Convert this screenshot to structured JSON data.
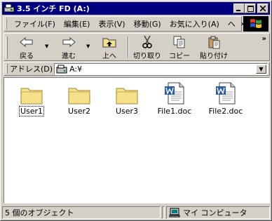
{
  "window": {
    "title": "3.5 インチ FD (A:)",
    "buttons": {
      "minimize": "_",
      "maximize": "□",
      "close": "×"
    }
  },
  "menu": {
    "items": [
      "ファイル(F)",
      "編集(E)",
      "表示(V)",
      "移動(G)",
      "お気に入り(A)",
      "ヘ"
    ],
    "more": "»"
  },
  "toolbar": {
    "back": "戻る",
    "forward": "進む",
    "up": "上へ",
    "cut": "切り取り",
    "copy": "コピー",
    "paste": "貼り付け",
    "more": "»",
    "dropdown_glyph": "▼"
  },
  "address": {
    "label": "アドレス(D)",
    "value": "A:¥",
    "dropdown_glyph": "▼"
  },
  "files": [
    {
      "name": "User1",
      "kind": "folder",
      "icon": "folder-icon"
    },
    {
      "name": "User2",
      "kind": "folder",
      "icon": "folder-icon"
    },
    {
      "name": "User3",
      "kind": "folder",
      "icon": "folder-icon"
    },
    {
      "name": "File1.doc",
      "kind": "word",
      "icon": "word-document-icon"
    },
    {
      "name": "File2.doc",
      "kind": "word",
      "icon": "word-document-icon"
    }
  ],
  "status": {
    "count": "5 個のオブジェクト",
    "location": "マイ コンピュータ"
  },
  "colors": {
    "titlebar": "#000080",
    "face": "#d4d0c8",
    "folder": "#f7e08a",
    "word_blue": "#2a5caa"
  }
}
